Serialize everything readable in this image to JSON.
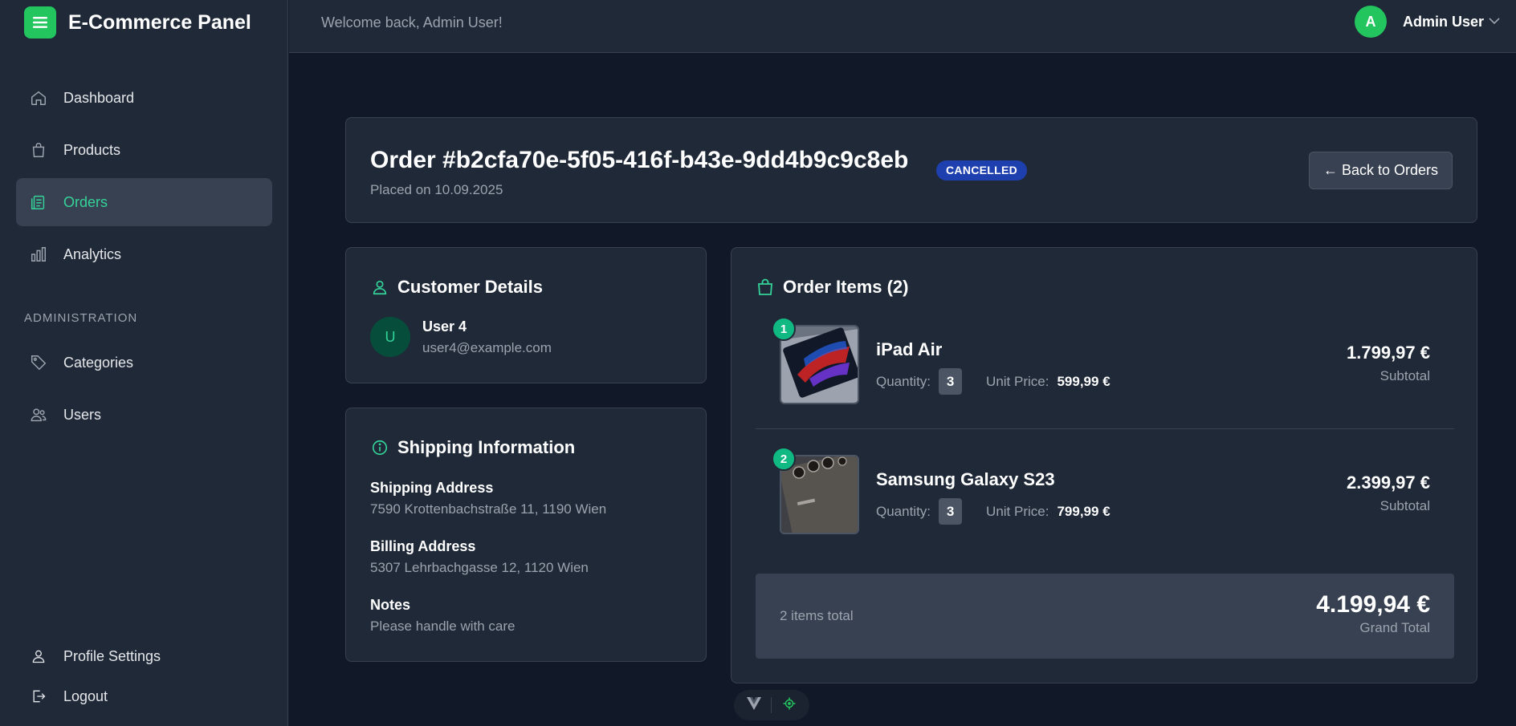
{
  "app": {
    "title": "E-Commerce Panel",
    "accent": "#22c55e"
  },
  "sidebar": {
    "items": [
      {
        "label": "Dashboard",
        "icon": "home-icon"
      },
      {
        "label": "Products",
        "icon": "shopping-bag-icon"
      },
      {
        "label": "Orders",
        "icon": "clipboard-list-icon",
        "active": true
      },
      {
        "label": "Analytics",
        "icon": "bar-chart-icon"
      }
    ],
    "section_label": "ADMINISTRATION",
    "admin_items": [
      {
        "label": "Categories",
        "icon": "tag-icon"
      },
      {
        "label": "Users",
        "icon": "users-icon"
      }
    ],
    "bottom_items": [
      {
        "label": "Profile Settings",
        "icon": "user-icon"
      },
      {
        "label": "Logout",
        "icon": "logout-icon"
      }
    ]
  },
  "topbar": {
    "welcome": "Welcome back, Admin User!",
    "avatar_initial": "A",
    "user_name": "Admin User"
  },
  "order": {
    "title": "Order #b2cfa70e-5f05-416f-b43e-9dd4b9c9c8eb",
    "status": "CANCELLED",
    "status_color": "#1e40af",
    "placed_on": "Placed on 10.09.2025",
    "back_label": "← Back to Orders"
  },
  "customer": {
    "heading": "Customer Details",
    "initial": "U",
    "name": "User 4",
    "email": "user4@example.com"
  },
  "shipping": {
    "heading": "Shipping Information",
    "shipping_label": "Shipping Address",
    "shipping_value": "7590 Krottenbachstraße 11, 1190 Wien",
    "billing_label": "Billing Address",
    "billing_value": "5307 Lehrbachgasse 12, 1120 Wien",
    "notes_label": "Notes",
    "notes_value": "Please handle with care"
  },
  "items": {
    "heading": "Order Items (2)",
    "quantity_label": "Quantity:",
    "unit_price_label": "Unit Price:",
    "subtotal_label": "Subtotal",
    "list": [
      {
        "index": "1",
        "name": "iPad Air",
        "quantity": "3",
        "unit_price": "599,99 €",
        "subtotal": "1.799,97 €"
      },
      {
        "index": "2",
        "name": "Samsung Galaxy S23",
        "quantity": "3",
        "unit_price": "799,99 €",
        "subtotal": "2.399,97 €"
      }
    ],
    "total_count": "2 items total",
    "grand_total": "4.199,94 €",
    "grand_total_label": "Grand Total"
  }
}
